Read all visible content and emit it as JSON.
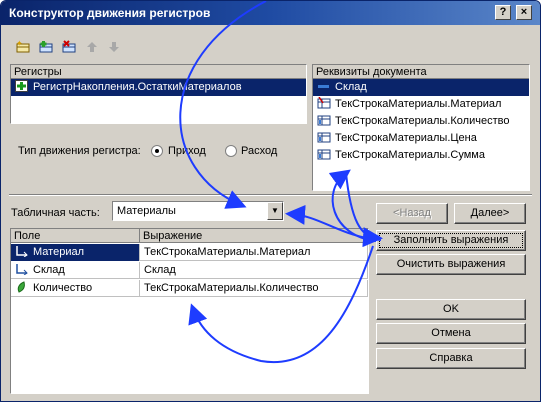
{
  "window": {
    "title": "Конструктор движения регистров",
    "help_label": "?",
    "close_label": "×"
  },
  "toolbar": {
    "icons": [
      "add-register-icon",
      "add-row-icon",
      "delete-icon",
      "move-up-icon",
      "move-down-icon"
    ]
  },
  "registers": {
    "header": "Регистры",
    "items": [
      {
        "label": "РегистрНакопления.ОстаткиМатериалов",
        "selected": true,
        "icon": "accumulation-register-icon"
      }
    ]
  },
  "movement_type": {
    "label": "Тип движения регистра:",
    "options": [
      {
        "label": "Приход",
        "selected": true
      },
      {
        "label": "Расход",
        "selected": false
      }
    ]
  },
  "doc_attributes": {
    "header": "Реквизиты документа",
    "items": [
      {
        "label": "Склад",
        "selected": true,
        "icon": "attribute-icon"
      },
      {
        "label": "ТекСтрокаМатериалы.Материал",
        "selected": false,
        "icon": "table-attribute-icon"
      },
      {
        "label": "ТекСтрокаМатериалы.Количество",
        "selected": false,
        "icon": "table-attribute-icon"
      },
      {
        "label": "ТекСтрокаМатериалы.Цена",
        "selected": false,
        "icon": "table-attribute-icon"
      },
      {
        "label": "ТекСтрокаМатериалы.Сумма",
        "selected": false,
        "icon": "table-attribute-icon"
      }
    ]
  },
  "tabular_part": {
    "label": "Табличная часть:",
    "value": "Материалы"
  },
  "nav": {
    "back_label": "<Назад",
    "next_label": "Далее>"
  },
  "fields_grid": {
    "columns": [
      "Поле",
      "Выражение"
    ],
    "rows": [
      {
        "field": "Материал",
        "expression": "ТекСтрокаМатериалы.Материал",
        "icon": "dimension-icon",
        "selected": true
      },
      {
        "field": "Склад",
        "expression": "Склад",
        "icon": "dimension-icon",
        "selected": false
      },
      {
        "field": "Количество",
        "expression": "ТекСтрокаМатериалы.Количество",
        "icon": "resource-icon",
        "selected": false
      }
    ]
  },
  "actions": {
    "fill_label": "Заполнить выражения",
    "clear_label": "Очистить выражения",
    "ok_label": "OK",
    "cancel_label": "Отмена",
    "help_label": "Справка"
  },
  "colors": {
    "selection": "#0a246a",
    "arrow": "#1e3cff",
    "face": "#d4d0c8"
  }
}
